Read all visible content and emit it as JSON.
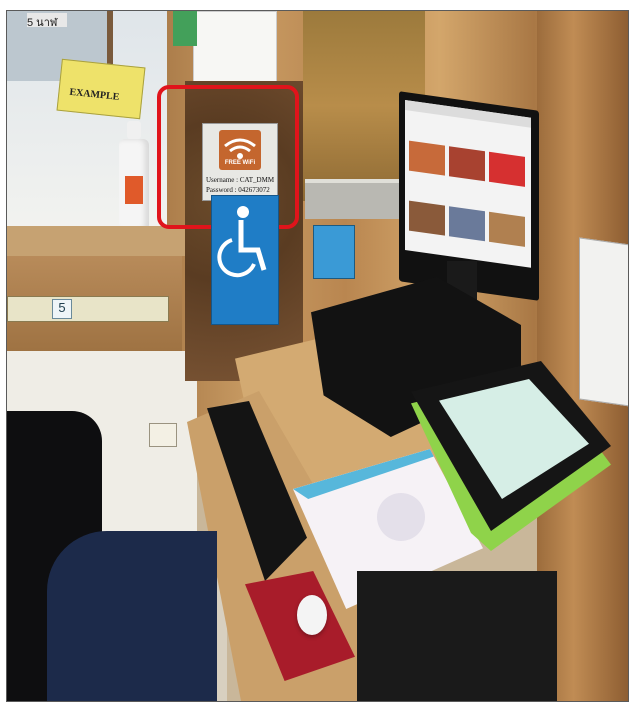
{
  "signs": {
    "counter_number": "5",
    "wifi": {
      "label": "FREE WiFi",
      "username": "Username : CAT_DMM",
      "password": "Password : 042673072"
    },
    "example_label": "EXAMPLE"
  },
  "colors": {
    "highlight": "#e0141b",
    "wifi_sign": "#c4662e",
    "access_sign": "#1f7dc6",
    "mousepad": "#a81c2a",
    "binder_green": "#8fd34a"
  }
}
